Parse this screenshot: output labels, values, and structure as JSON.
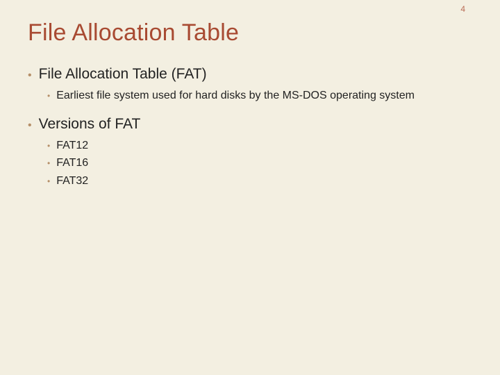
{
  "page_number": "4",
  "title": "File Allocation Table",
  "bullets": [
    {
      "text": "File Allocation Table (FAT)",
      "children": [
        {
          "text": "Earliest file system used for hard disks by the MS-DOS operating system"
        }
      ]
    },
    {
      "text": "Versions of FAT",
      "children": [
        {
          "text": "FAT12"
        },
        {
          "text": "FAT16"
        },
        {
          "text": "FAT32"
        }
      ]
    }
  ]
}
